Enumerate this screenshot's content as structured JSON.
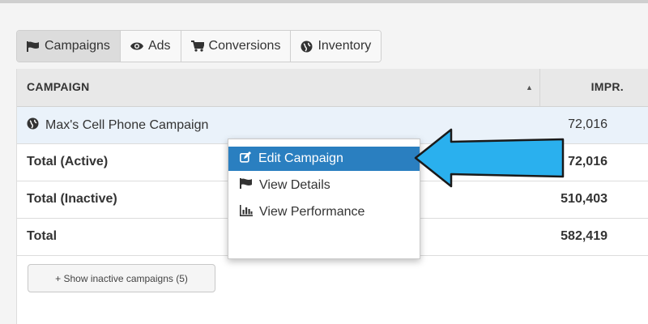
{
  "tabs": [
    {
      "label": "Campaigns",
      "icon": "flag-icon",
      "active": true
    },
    {
      "label": "Ads",
      "icon": "eye-icon",
      "active": false
    },
    {
      "label": "Conversions",
      "icon": "cart-icon",
      "active": false
    },
    {
      "label": "Inventory",
      "icon": "globe-icon",
      "active": false
    }
  ],
  "table": {
    "headers": {
      "campaign": "CAMPAIGN",
      "impressions": "IMPR."
    },
    "sort_indicator": "▲",
    "rows": [
      {
        "name": "Max's Cell Phone Campaign",
        "impressions": "72,016",
        "icon": "globe-icon"
      },
      {
        "name": "Total (Active)",
        "impressions": "72,016"
      },
      {
        "name": "Total (Inactive)",
        "impressions": "510,403"
      },
      {
        "name": "Total",
        "impressions": "582,419"
      }
    ]
  },
  "show_inactive_label": "+ Show inactive campaigns (5)",
  "context_menu": {
    "items": [
      {
        "label": "Edit Campaign",
        "icon": "edit-icon",
        "selected": true
      },
      {
        "label": "View Details",
        "icon": "flag-icon",
        "selected": false
      },
      {
        "label": "View Performance",
        "icon": "bar-chart-icon",
        "selected": false
      }
    ]
  },
  "colors": {
    "menu_highlight": "#2a7fc0",
    "row_highlight": "#eaf2fa",
    "arrow_fill": "#2ab0ee",
    "arrow_stroke": "#1a1a1a"
  }
}
